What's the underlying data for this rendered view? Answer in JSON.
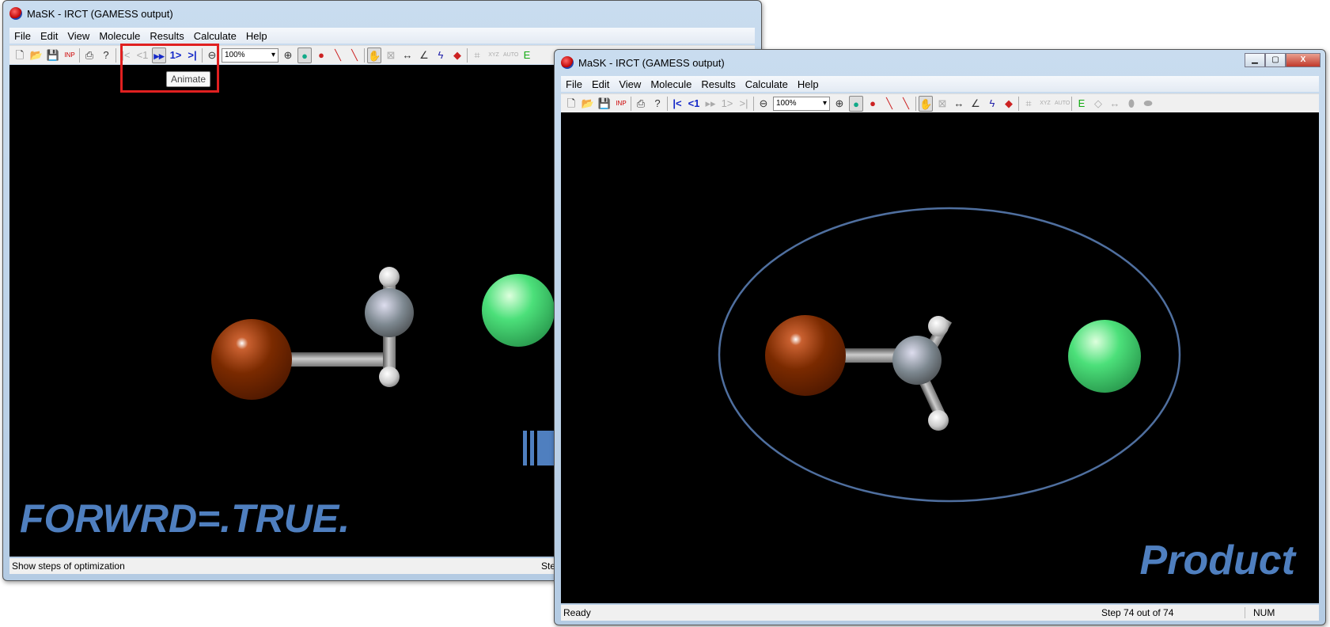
{
  "left_window": {
    "title": "MaSK - IRCT (GAMESS output)",
    "menu": [
      "File",
      "Edit",
      "View",
      "Molecule",
      "Results",
      "Calculate",
      "Help"
    ],
    "zoom_value": "100%",
    "tooltip": "Animate",
    "status_text": "Show steps of optimization",
    "status_step": "Ste",
    "overlay_label": "FORWRD=.TRUE."
  },
  "right_window": {
    "title": "MaSK - IRCT (GAMESS output)",
    "menu": [
      "File",
      "Edit",
      "View",
      "Molecule",
      "Results",
      "Calculate",
      "Help"
    ],
    "zoom_value": "100%",
    "status_text": "Ready",
    "status_step": "Step 74 out of 74",
    "status_num": "NUM",
    "overlay_label": "Product"
  },
  "colors": {
    "highlight_box": "#e02020",
    "accent": "#4f7fbf",
    "bromine": "#7a2a00",
    "chlorine": "#4ce07a",
    "carbon": "#7d8890",
    "hydrogen": "#e0e0e0"
  }
}
